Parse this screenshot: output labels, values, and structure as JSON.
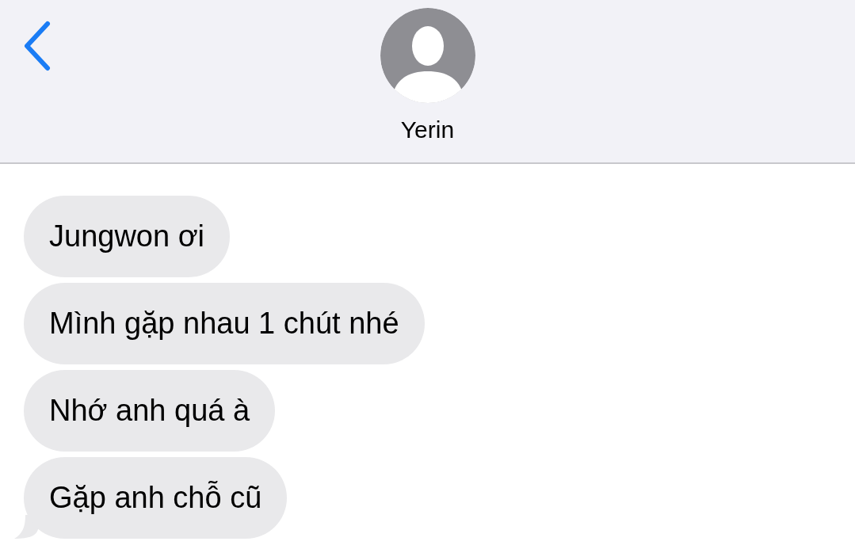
{
  "header": {
    "contact_name": "Yerin"
  },
  "messages": [
    {
      "text": "Jungwon ơi",
      "tail": false
    },
    {
      "text": "Mình gặp nhau 1 chút nhé",
      "tail": false
    },
    {
      "text": "Nhớ anh quá à",
      "tail": false
    },
    {
      "text": "Gặp anh chỗ cũ",
      "tail": true
    }
  ]
}
